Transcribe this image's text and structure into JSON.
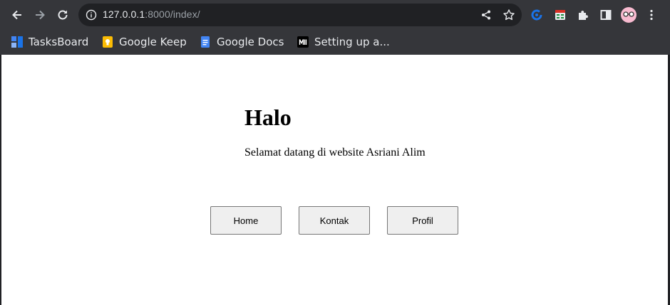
{
  "browser": {
    "url_host": "127.0.0.1",
    "url_rest": ":8000/index/",
    "icons": {
      "back": "arrow-left-icon",
      "forward": "arrow-right-icon",
      "reload": "reload-icon",
      "info": "info-icon",
      "share": "share-icon",
      "bookmark": "star-icon",
      "extension_1": "extension-blue-icon",
      "extension_2": "extension-table-icon",
      "extensions": "puzzle-icon",
      "sidepanel": "side-panel-icon",
      "profile": "avatar",
      "menu": "kebab-menu-icon"
    }
  },
  "bookmarks": [
    {
      "label": "TasksBoard",
      "icon": "tasksboard-icon"
    },
    {
      "label": "Google Keep",
      "icon": "google-keep-icon"
    },
    {
      "label": "Google Docs",
      "icon": "google-docs-icon"
    },
    {
      "label": "Setting up a...",
      "icon": "medium-icon"
    }
  ],
  "page": {
    "heading": "Halo",
    "welcome": "Selamat datang di website Asriani Alim",
    "buttons": {
      "home": "Home",
      "kontak": "Kontak",
      "profil": "Profil"
    }
  },
  "colors": {
    "chrome_bg": "#35363a",
    "omnibox_bg": "#202124",
    "page_bg": "#ffffff",
    "button_bg": "#efefef",
    "button_border": "#767676"
  }
}
